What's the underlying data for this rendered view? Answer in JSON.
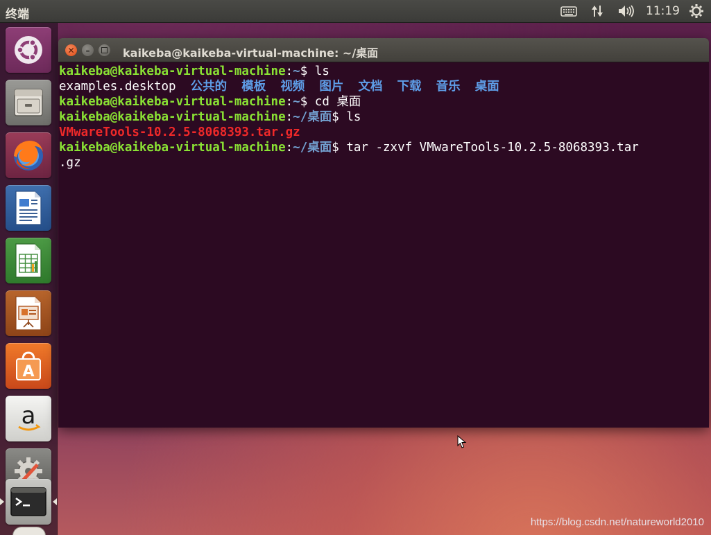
{
  "top_panel": {
    "app_title": "终端",
    "clock": "11:19",
    "icons": [
      "keyboard-icon",
      "network-icon",
      "volume-icon",
      "power-gear-icon"
    ]
  },
  "launcher": {
    "items": [
      {
        "name": "ubuntu-dash",
        "icon": "ubuntu-logo-icon",
        "color": "#e95420"
      },
      {
        "name": "files",
        "icon": "file-cabinet-icon",
        "color": "#8d8d8d"
      },
      {
        "name": "firefox",
        "icon": "firefox-icon",
        "color": "#e66000"
      },
      {
        "name": "writer",
        "icon": "document-writer-icon",
        "color": "#2a6bb6"
      },
      {
        "name": "calc",
        "icon": "spreadsheet-calc-icon",
        "color": "#3b8e36"
      },
      {
        "name": "impress",
        "icon": "presentation-impress-icon",
        "color": "#b8571e"
      },
      {
        "name": "software",
        "icon": "shopping-bag-icon",
        "color": "#e55a1c"
      },
      {
        "name": "amazon",
        "icon": "amazon-logo-icon",
        "color": "#f3f3f3",
        "label": "a"
      },
      {
        "name": "settings",
        "icon": "system-settings-icon",
        "color": "#777777"
      },
      {
        "name": "terminal",
        "icon": "terminal-icon",
        "color": "#3c3c3c"
      }
    ]
  },
  "window": {
    "title": "kaikeba@kaikeba-virtual-machine: ~/桌面"
  },
  "terminal": {
    "lines": [
      {
        "user": "kaikeba@kaikeba-virtual-machine",
        "path": "~",
        "command": "ls"
      },
      {
        "files": [
          "examples.desktop"
        ],
        "dirs": [
          "公共的",
          "模板",
          "视频",
          "图片",
          "文档",
          "下载",
          "音乐",
          "桌面"
        ]
      },
      {
        "user": "kaikeba@kaikeba-virtual-machine",
        "path": "~",
        "command": "cd 桌面"
      },
      {
        "user": "kaikeba@kaikeba-virtual-machine",
        "path": "~/桌面",
        "command": "ls"
      },
      {
        "archive": "VMwareTools-10.2.5-8068393.tar.gz"
      },
      {
        "user": "kaikeba@kaikeba-virtual-machine",
        "path": "~/桌面",
        "command": "tar -zxvf VMwareTools-10.2.5-8068393.tar"
      },
      {
        "continuation": ".gz"
      }
    ]
  },
  "watermark": "https://blog.csdn.net/natureworld2010"
}
